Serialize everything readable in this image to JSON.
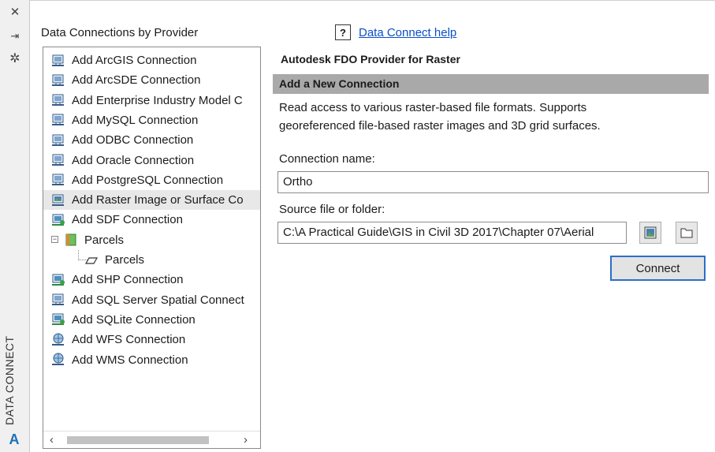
{
  "palette": {
    "title": "DATA CONNECT",
    "tools": [
      {
        "name": "close",
        "glyph": "✕"
      },
      {
        "name": "autohide",
        "glyph": "⇥"
      },
      {
        "name": "properties",
        "glyph": "✲"
      }
    ],
    "logo_glyph": "A"
  },
  "providers_caption": "Data Connections by Provider",
  "tree": {
    "items": [
      {
        "label": "Add ArcGIS Connection",
        "icon": "db-connection-icon",
        "indent": 0
      },
      {
        "label": "Add ArcSDE Connection",
        "icon": "db-connection-icon",
        "indent": 0
      },
      {
        "label": "Add Enterprise Industry Model C",
        "icon": "db-connection-icon",
        "indent": 0
      },
      {
        "label": "Add MySQL Connection",
        "icon": "db-connection-icon",
        "indent": 0
      },
      {
        "label": "Add ODBC Connection",
        "icon": "db-connection-icon",
        "indent": 0
      },
      {
        "label": "Add Oracle Connection",
        "icon": "db-connection-icon",
        "indent": 0
      },
      {
        "label": "Add PostgreSQL Connection",
        "icon": "db-connection-icon",
        "indent": 0
      },
      {
        "label": "Add Raster Image or Surface Co",
        "icon": "raster-connection-icon",
        "indent": 0,
        "selected": true
      },
      {
        "label": "Add SDF Connection",
        "icon": "file-connection-icon",
        "indent": 0
      },
      {
        "label": "Parcels",
        "icon": "feature-source-icon",
        "indent": 1
      },
      {
        "label": "Parcels",
        "icon": "polygon-layer-icon",
        "indent": 2
      },
      {
        "label": "Add SHP Connection",
        "icon": "file-connection-icon",
        "indent": 0
      },
      {
        "label": "Add SQL Server Spatial Connect",
        "icon": "db-connection-icon",
        "indent": 0
      },
      {
        "label": "Add SQLite Connection",
        "icon": "file-connection-icon",
        "indent": 0
      },
      {
        "label": "Add WFS Connection",
        "icon": "web-connection-icon",
        "indent": 0
      },
      {
        "label": "Add WMS Connection",
        "icon": "web-connection-icon",
        "indent": 0
      }
    ],
    "scroll_left": "‹",
    "scroll_right": "›"
  },
  "help": {
    "glyph": "?",
    "link_text": "Data Connect help"
  },
  "provider_name": "Autodesk FDO Provider for Raster",
  "section_header": "Add a New Connection",
  "description_line1": "Read access to various raster-based file formats.  Supports",
  "description_line2": "georeferenced file-based raster images and 3D grid surfaces.",
  "connection_name": {
    "label": "Connection name:",
    "value": "Ortho"
  },
  "source": {
    "label": "Source file or folder:",
    "value": "C:\\A Practical Guide\\GIS in Civil 3D 2017\\Chapter 07\\Aerial"
  },
  "connect_button": "Connect",
  "colors": {
    "header_bg": "#a9a9a9",
    "link": "#0a50c8",
    "focus_border": "#2b6fc7"
  }
}
